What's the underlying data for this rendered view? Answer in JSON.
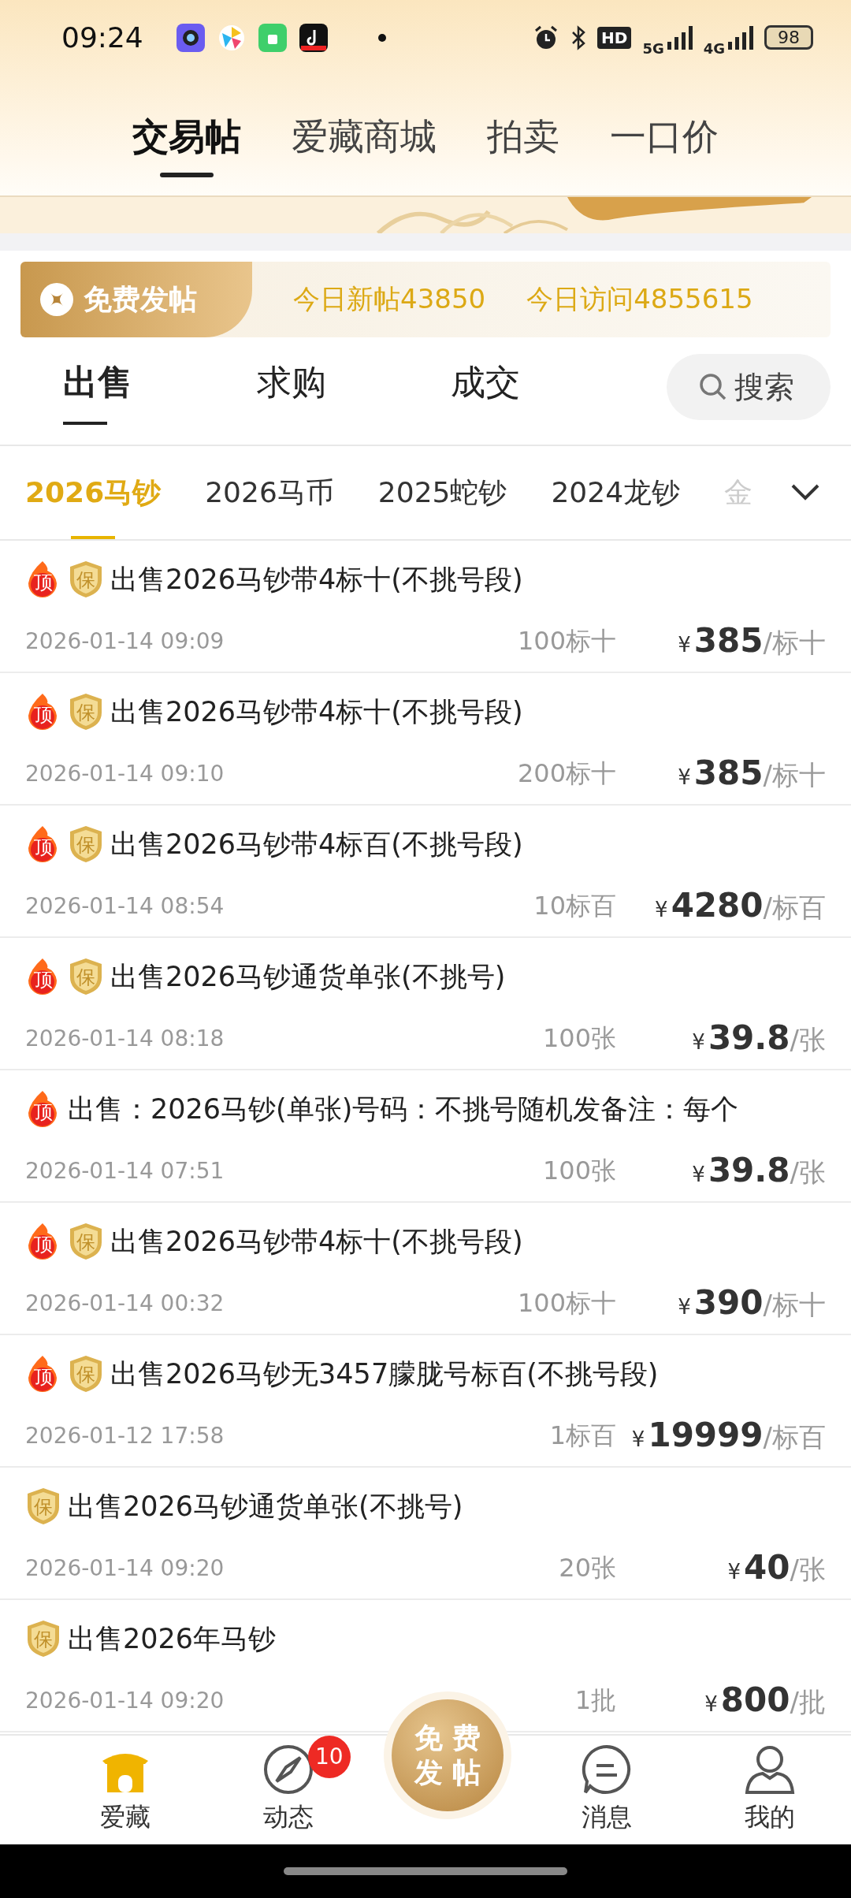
{
  "status_bar": {
    "time": "09:24",
    "hd": "HD",
    "network_5g": "5G",
    "network_4g": "4G",
    "battery": "98"
  },
  "top_tabs": [
    {
      "label": "交易帖",
      "selected": true
    },
    {
      "label": "爱藏商城",
      "selected": false
    },
    {
      "label": "拍卖",
      "selected": false
    },
    {
      "label": "一口价",
      "selected": false
    }
  ],
  "stats": {
    "post_button": "免费发帖",
    "new_posts": "今日新帖43850",
    "visits": "今日访问4855615"
  },
  "trade_tabs": [
    {
      "label": "出售",
      "selected": true
    },
    {
      "label": "求购",
      "selected": false
    },
    {
      "label": "成交",
      "selected": false
    }
  ],
  "search": {
    "placeholder": "搜索"
  },
  "categories": [
    {
      "label": "2026马钞",
      "selected": true,
      "faded": false
    },
    {
      "label": "2026马币",
      "selected": false,
      "faded": false
    },
    {
      "label": "2025蛇钞",
      "selected": false,
      "faded": false
    },
    {
      "label": "2024龙钞",
      "selected": false,
      "faded": false
    },
    {
      "label": "金",
      "selected": false,
      "faded": true
    }
  ],
  "listings": [
    {
      "top_badge": "顶",
      "guarantee_badge": "保",
      "title": "出售2026马钞带4标十(不挑号段)",
      "time": "2026-01-14 09:09",
      "quantity": "100标十",
      "currency": "¥",
      "price": "385",
      "unit": "/标十"
    },
    {
      "top_badge": "顶",
      "guarantee_badge": "保",
      "title": "出售2026马钞带4标十(不挑号段)",
      "time": "2026-01-14 09:10",
      "quantity": "200标十",
      "currency": "¥",
      "price": "385",
      "unit": "/标十"
    },
    {
      "top_badge": "顶",
      "guarantee_badge": "保",
      "title": "出售2026马钞带4标百(不挑号段)",
      "time": "2026-01-14 08:54",
      "quantity": "10标百",
      "currency": "¥",
      "price": "4280",
      "unit": "/标百"
    },
    {
      "top_badge": "顶",
      "guarantee_badge": "保",
      "title": "出售2026马钞通货单张(不挑号)",
      "time": "2026-01-14 08:18",
      "quantity": "100张",
      "currency": "¥",
      "price": "39.8",
      "unit": "/张"
    },
    {
      "top_badge": "顶",
      "title": "出售：2026马钞(单张)号码：不挑号随机发备注：每个",
      "time": "2026-01-14 07:51",
      "quantity": "100张",
      "currency": "¥",
      "price": "39.8",
      "unit": "/张"
    },
    {
      "top_badge": "顶",
      "guarantee_badge": "保",
      "title": "出售2026马钞带4标十(不挑号段)",
      "time": "2026-01-14 00:32",
      "quantity": "100标十",
      "currency": "¥",
      "price": "390",
      "unit": "/标十"
    },
    {
      "top_badge": "顶",
      "guarantee_badge": "保",
      "title": "出售2026马钞无3457朦胧号标百(不挑号段)",
      "time": "2026-01-12 17:58",
      "quantity": "1标百",
      "currency": "¥",
      "price": "19999",
      "unit": "/标百"
    },
    {
      "guarantee_badge": "保",
      "title": "出售2026马钞通货单张(不挑号)",
      "time": "2026-01-14 09:20",
      "quantity": "20张",
      "currency": "¥",
      "price": "40",
      "unit": "/张"
    },
    {
      "guarantee_badge": "保",
      "title": "出售2026年马钞",
      "time": "2026-01-14 09:20",
      "quantity": "1批",
      "currency": "¥",
      "price": "800",
      "unit": "/批"
    }
  ],
  "bottom_nav": [
    {
      "kind": "home",
      "label": "爱藏",
      "selected": true
    },
    {
      "kind": "feed",
      "label": "动态",
      "selected": false,
      "badge": "10"
    },
    {
      "kind": "post",
      "lines": [
        "免费",
        "发帖"
      ],
      "selected": false
    },
    {
      "kind": "message",
      "label": "消息",
      "selected": false
    },
    {
      "kind": "profile",
      "label": "我的",
      "selected": false
    }
  ]
}
